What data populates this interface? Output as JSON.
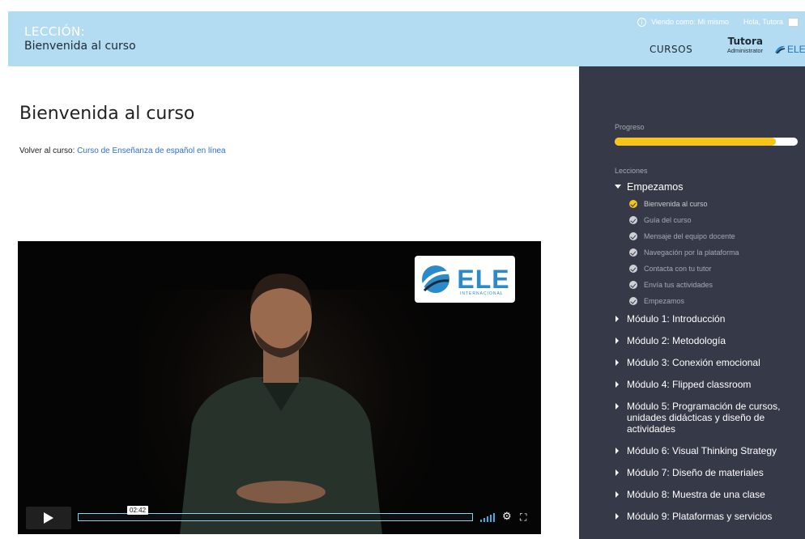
{
  "header": {
    "kicker": "LECCIÓN:",
    "lesson_title": "Bienvenida al curso",
    "view_as": "Viendo como: Mi mismo",
    "greeting": "Hola, Tutora",
    "nav_courses": "CURSOS",
    "user_name": "Tutora",
    "user_role": "Administrator",
    "brand": "ELE"
  },
  "main": {
    "title": "Bienvenida al curso",
    "back_prefix": "Volver al curso:",
    "back_link": "Curso de Enseñanza de español en línea"
  },
  "video": {
    "logo_text": "ELE",
    "logo_subtext": "INTERNACIONAL",
    "time": "02:42"
  },
  "sidebar": {
    "progress_label": "Progreso",
    "progress_value": 0.88,
    "lessons_label": "Lecciones",
    "open_section": "Empezamos",
    "lessons": [
      {
        "label": "Bienvenida al curso",
        "active": true
      },
      {
        "label": "Guía del curso",
        "active": false
      },
      {
        "label": "Mensaje del equipo docente",
        "active": false
      },
      {
        "label": "Navegación por la plataforma",
        "active": false
      },
      {
        "label": "Contacta con tu tutor",
        "active": false
      },
      {
        "label": "Envía tus actividades",
        "active": false
      },
      {
        "label": "Empezamos",
        "active": false
      }
    ],
    "modules": [
      {
        "label": "Módulo 1: Introducción"
      },
      {
        "label": "Módulo 2: Metodología"
      },
      {
        "label": "Módulo 3: Conexión emocional"
      },
      {
        "label": "Módulo 4: Flipped classroom"
      },
      {
        "label": "Módulo 5: Programación de cursos, unidades didácticas y diseño de actividades"
      },
      {
        "label": "Módulo 6: Visual Thinking Strategy"
      },
      {
        "label": "Módulo 7: Diseño de materiales"
      },
      {
        "label": "Módulo 8: Muestra de una clase"
      },
      {
        "label": "Módulo 9: Plataformas y servicios"
      }
    ]
  },
  "colors": {
    "header_bg": "#b3dbf2",
    "sidebar_bg": "#363947",
    "progress": "#f7c41b",
    "link": "#2b6fd6",
    "brand_blue": "#2b8ac9"
  }
}
